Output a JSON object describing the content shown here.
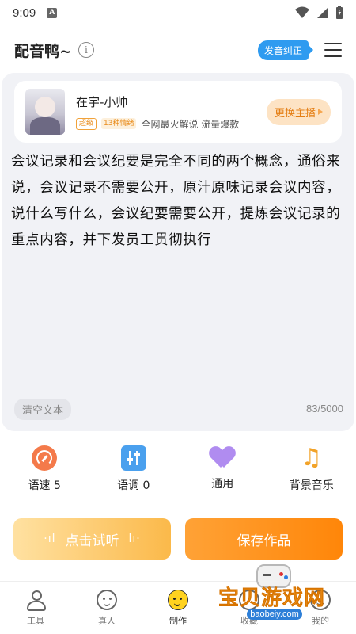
{
  "status_bar": {
    "time": "9:09",
    "notification_icon": "a-icon",
    "icons": [
      "wifi-icon",
      "signal-icon",
      "battery-icon"
    ]
  },
  "header": {
    "title": "配音鸭~",
    "info_icon": "info-icon",
    "pronunciation_button": "发音纠正",
    "menu_icon": "menu-icon"
  },
  "anchor": {
    "name": "在宇-小帅",
    "level_tag": "超级",
    "emotion_tag": "13种情绪",
    "description": "全网最火解说 流量爆款",
    "change_button": "更换主播"
  },
  "editor": {
    "text": "会议记录和会议纪要是完全不同的两个概念，通俗来说，会议记录不需要公开，原汁原味记录会议内容，说什么写什么，会议纪要需要公开，提炼会议记录的重点内容，并下发员工贯彻执行",
    "clear_button": "清空文本",
    "char_count": "83/5000"
  },
  "settings": [
    {
      "label": "语速 5",
      "icon": "speed-gauge-icon",
      "color": "#f47a4a"
    },
    {
      "label": "语调 0",
      "icon": "tone-slider-icon",
      "color": "#4aa0ee"
    },
    {
      "label": "通用",
      "icon": "heart-icon",
      "color": "#b08cf0"
    },
    {
      "label": "背景音乐",
      "icon": "music-note-icon",
      "color": "#f2a329"
    }
  ],
  "actions": {
    "listen": "点击试听",
    "save": "保存作品"
  },
  "bottom_nav": [
    {
      "label": "工具",
      "icon": "tools-icon",
      "active": false
    },
    {
      "label": "真人",
      "icon": "human-face-icon",
      "active": false
    },
    {
      "label": "制作",
      "icon": "make-face-icon",
      "active": true
    },
    {
      "label": "收藏",
      "icon": "favorite-icon",
      "active": false
    },
    {
      "label": "我的",
      "icon": "profile-icon",
      "active": false
    }
  ],
  "watermark": {
    "title": "宝贝游戏网",
    "url": "baobeiy.com"
  },
  "colors": {
    "accent_orange": "#ff8609",
    "accent_blue": "#2f9bf0",
    "panel_bg": "#f1f2f6"
  }
}
